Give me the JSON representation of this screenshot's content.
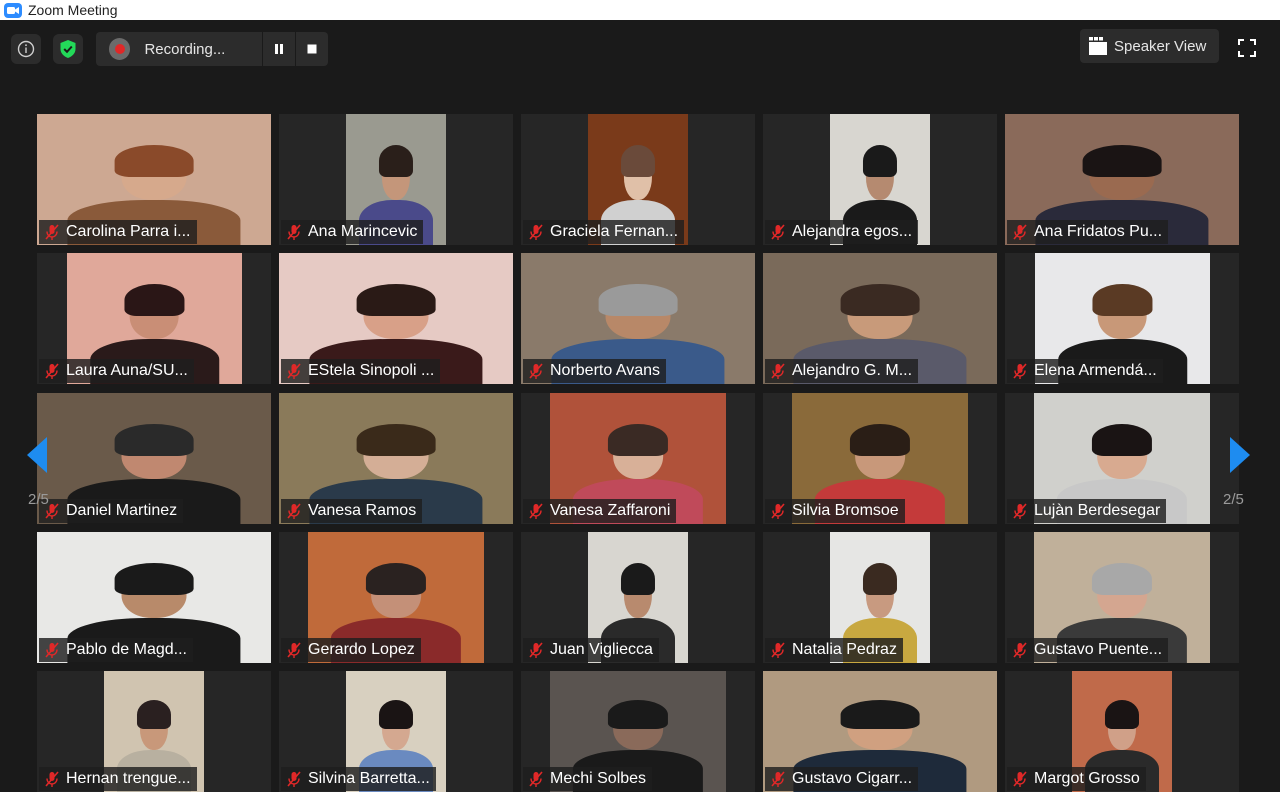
{
  "window": {
    "title": "Zoom Meeting"
  },
  "toolbar": {
    "recording_label": "Recording...",
    "speaker_view_label": "Speaker View"
  },
  "pagination": {
    "left": "2/5",
    "right": "2/5"
  },
  "colors": {
    "accent": "#2d8cff",
    "muted_red": "#e02828",
    "shield_green": "#23d959",
    "arrow_blue": "#1e8cf0"
  },
  "participants": [
    {
      "name": "Carolina Parra i...",
      "bg": "#cda892",
      "shirt": "#8a5a3a",
      "skin": "#d6a98c",
      "hair": "#8a4a2a"
    },
    {
      "name": "Ana Marincevic",
      "bg": "#9a9a90",
      "shirt": "#4a4a8a",
      "skin": "#c4967a",
      "hair": "#2a1f1a"
    },
    {
      "name": "Graciela Fernan...",
      "bg": "#7a3a1a",
      "shirt": "#d0d0d0",
      "skin": "#e0c0a8",
      "hair": "#6a4a3a"
    },
    {
      "name": "Alejandra egos...",
      "bg": "#d8d6d0",
      "shirt": "#1a1a1a",
      "skin": "#b58a70",
      "hair": "#1a1a1a"
    },
    {
      "name": "Ana Fridatos Pu...",
      "bg": "#8a6a5a",
      "shirt": "#2a2a3a",
      "skin": "#9a6a50",
      "hair": "#1a1414"
    },
    {
      "name": "Laura Auna/SU...",
      "bg": "#e0a89a",
      "shirt": "#2a1a1a",
      "skin": "#c98e76",
      "hair": "#2a1616"
    },
    {
      "name": "EStela Sinopoli ...",
      "bg": "#e6cac4",
      "shirt": "#3a1a1a",
      "skin": "#d8a088",
      "hair": "#2a1a16"
    },
    {
      "name": "Norberto Avans",
      "bg": "#8a7a6a",
      "shirt": "#3a5a8a",
      "skin": "#b88868",
      "hair": "#9a9a9a"
    },
    {
      "name": "Alejandro G. M...",
      "bg": "#7a6a5a",
      "shirt": "#5a5a6a",
      "skin": "#c89a7a",
      "hair": "#3a2a22"
    },
    {
      "name": "Elena Armendá...",
      "bg": "#e8e8ea",
      "shirt": "#1a1a1a",
      "skin": "#c89878",
      "hair": "#5a3a24"
    },
    {
      "name": "Daniel Martinez",
      "bg": "#6a5a4a",
      "shirt": "#1a1a1a",
      "skin": "#c08870",
      "hair": "#2a2a2a"
    },
    {
      "name": "Vanesa Ramos",
      "bg": "#8a7a5a",
      "shirt": "#2a3a4a",
      "skin": "#d4ae96",
      "hair": "#3a2a1a"
    },
    {
      "name": "Vanesa Zaffaroni",
      "bg": "#b0523a",
      "shirt": "#c04a5a",
      "skin": "#d8b098",
      "hair": "#3a2a24"
    },
    {
      "name": "Silvia Bromsoe",
      "bg": "#8a6a3a",
      "shirt": "#c43a3a",
      "skin": "#c8987a",
      "hair": "#2a1e16"
    },
    {
      "name": "Lujàn Berdesegar",
      "bg": "#d0d0cc",
      "shirt": "#c8c8c8",
      "skin": "#d8aa90",
      "hair": "#1a1414"
    },
    {
      "name": "Pablo de Magd...",
      "bg": "#e8e8e6",
      "shirt": "#1a1a1a",
      "skin": "#b88a6a",
      "hair": "#1a1a1a"
    },
    {
      "name": "Gerardo Lopez",
      "bg": "#c06a3a",
      "shirt": "#8a2a2a",
      "skin": "#c49078",
      "hair": "#2a2220"
    },
    {
      "name": "Juan Viglieccа",
      "bg": "#d8d6d0",
      "shirt": "#2a2a2a",
      "skin": "#b88a6e",
      "hair": "#1a1a1a"
    },
    {
      "name": "Natalia Pedraz",
      "bg": "#e6e6e4",
      "shirt": "#c8a840",
      "skin": "#c89a80",
      "hair": "#3a2a20"
    },
    {
      "name": "Gustavo Puente...",
      "bg": "#c0b09a",
      "shirt": "#3a3a3a",
      "skin": "#d4a690",
      "hair": "#a8a8a8"
    },
    {
      "name": "Hernan trengue...",
      "bg": "#d0c4b0",
      "shirt": "#b8b0a0",
      "skin": "#c8987a",
      "hair": "#2a2020"
    },
    {
      "name": "Silvina Barretta...",
      "bg": "#d8d0c0",
      "shirt": "#6a8ac0",
      "skin": "#d4a890",
      "hair": "#1a1414"
    },
    {
      "name": "Mechi Solbes",
      "bg": "#5a5450",
      "shirt": "#1a1a1a",
      "skin": "#8a6a5a",
      "hair": "#1a1a1a"
    },
    {
      "name": "Gustavo Cigarr...",
      "bg": "#b09a80",
      "shirt": "#1e2a3a",
      "skin": "#d0a080",
      "hair": "#1a1a1a"
    },
    {
      "name": "Margot Grosso",
      "bg": "#c06a4a",
      "shirt": "#2a2a2a",
      "skin": "#d0a088",
      "hair": "#1a1414"
    }
  ]
}
